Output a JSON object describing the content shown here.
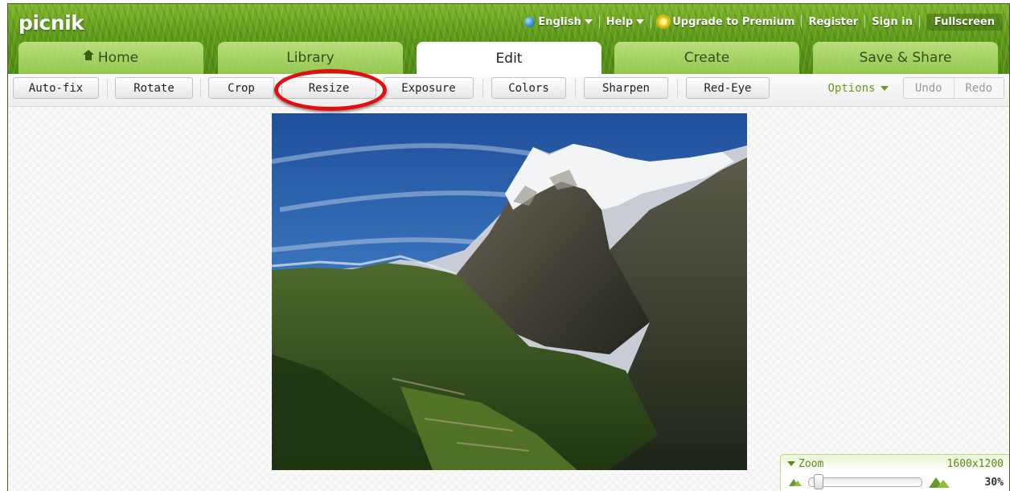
{
  "app": {
    "logo": "picnik"
  },
  "topnav": {
    "language": "English",
    "help": "Help",
    "upgrade": "Upgrade to Premium",
    "register": "Register",
    "signin": "Sign in",
    "fullscreen": "Fullscreen"
  },
  "tabs": [
    {
      "label": "Home",
      "active": false
    },
    {
      "label": "Library",
      "active": false
    },
    {
      "label": "Edit",
      "active": true
    },
    {
      "label": "Create",
      "active": false
    },
    {
      "label": "Save & Share",
      "active": false
    }
  ],
  "toolbar": {
    "autofix": "Auto-fix",
    "rotate": "Rotate",
    "crop": "Crop",
    "resize": "Resize",
    "exposure": "Exposure",
    "colors": "Colors",
    "sharpen": "Sharpen",
    "redeye": "Red-Eye",
    "options": "Options",
    "undo": "Undo",
    "redo": "Redo"
  },
  "zoom": {
    "title": "Zoom",
    "dimensions": "1600x1200",
    "percent": "30%",
    "level": 0.03
  },
  "colors": {
    "accent_green": "#6b9a1a",
    "highlight_red": "#e01010"
  }
}
